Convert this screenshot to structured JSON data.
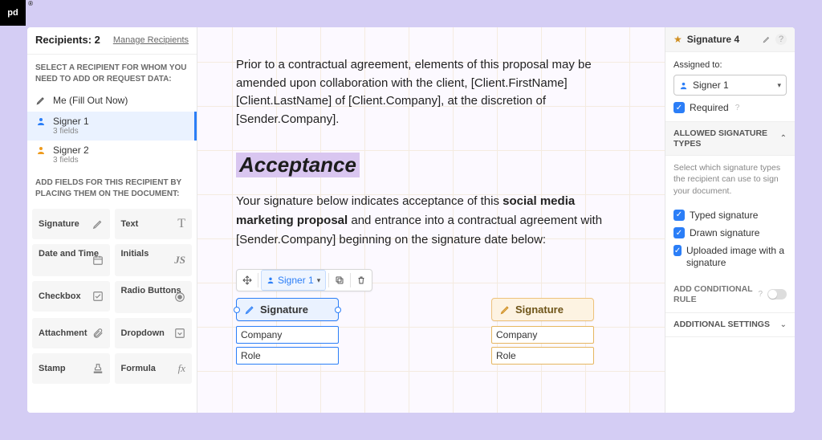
{
  "logo": "pd",
  "left": {
    "recipients_title": "Recipients: 2",
    "manage_link": "Manage Recipients",
    "select_label": "SELECT A RECIPIENT FOR WHOM YOU NEED TO ADD OR REQUEST DATA:",
    "me_row": "Me (Fill Out Now)",
    "signers": [
      {
        "name": "Signer 1",
        "sub": "3 fields",
        "color": "blue",
        "active": true
      },
      {
        "name": "Signer 2",
        "sub": "3 fields",
        "color": "orange",
        "active": false
      }
    ],
    "add_fields_label": "ADD FIELDS FOR THIS RECIPIENT BY PLACING THEM ON THE DOCUMENT:",
    "fields": [
      {
        "name": "Signature"
      },
      {
        "name": "Text"
      },
      {
        "name": "Date and Time"
      },
      {
        "name": "Initials"
      },
      {
        "name": "Checkbox"
      },
      {
        "name": "Radio Buttons"
      },
      {
        "name": "Attachment"
      },
      {
        "name": "Dropdown"
      },
      {
        "name": "Stamp"
      },
      {
        "name": "Formula"
      }
    ]
  },
  "doc": {
    "para1": "Prior to a contractual agreement, elements of this proposal may be amended upon collaboration with the client, [Client.FirstName] [Client.LastName] of [Client.Company], at the discretion of [Sender.Company].",
    "heading": "Acceptance",
    "para2a": "Your signature below indicates acceptance of this ",
    "para2b": "social media marketing proposal",
    "para2c": " and entrance into a contractual agreement with [Sender.Company] beginning on the signature date below:",
    "toolbar": {
      "signer_label": "Signer 1"
    },
    "sig_left": {
      "sig": "Signature",
      "company": "Company",
      "role": "Role"
    },
    "sig_right": {
      "sig": "Signature",
      "company": "Company",
      "role": "Role"
    }
  },
  "right": {
    "header_title": "Signature 4",
    "assigned_label": "Assigned to:",
    "assigned_value": "Signer 1",
    "required_label": "Required",
    "allowed_sig_types_title": "ALLOWED SIGNATURE TYPES",
    "allowed_hint": "Select which signature types the recipient can use to sign your document.",
    "sig_types": [
      "Typed signature",
      "Drawn signature",
      "Uploaded image with a signature"
    ],
    "add_cond_rule": "ADD CONDITIONAL RULE",
    "additional_settings": "ADDITIONAL SETTINGS"
  }
}
